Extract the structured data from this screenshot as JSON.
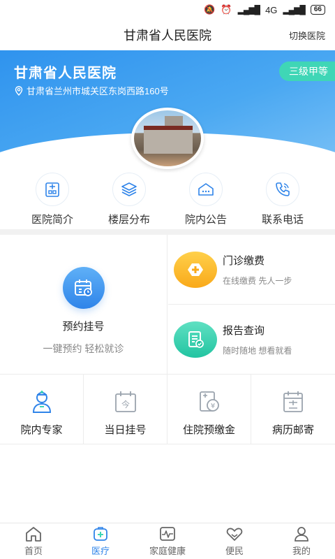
{
  "status_bar": {
    "network": "4G",
    "battery": "66"
  },
  "nav": {
    "title": "甘肃省人民医院",
    "switch_label": "切换医院"
  },
  "hero": {
    "name": "甘肃省人民医院",
    "address": "甘肃省兰州市城关区东岗西路160号",
    "level": "三级甲等",
    "photo_sign": "甘肃省人民医院"
  },
  "quick_menu": [
    {
      "label": "医院简介",
      "icon": "hospital-intro-icon"
    },
    {
      "label": "楼层分布",
      "icon": "floor-layers-icon"
    },
    {
      "label": "院内公告",
      "icon": "notice-icon"
    },
    {
      "label": "联系电话",
      "icon": "phone-icon"
    }
  ],
  "services": {
    "appointment": {
      "title": "预约挂号",
      "subtitle": "一键预约 轻松就诊"
    },
    "payment": {
      "title": "门诊缴费",
      "subtitle": "在线缴费 先人一步"
    },
    "report": {
      "title": "报告查询",
      "subtitle": "随时随地 想看就看"
    },
    "small": [
      {
        "label": "院内专家",
        "icon": "doctor-icon"
      },
      {
        "label": "当日挂号",
        "icon": "calendar-today-icon"
      },
      {
        "label": "住院预缴金",
        "icon": "deposit-icon"
      },
      {
        "label": "病历邮寄",
        "icon": "record-mail-icon"
      }
    ]
  },
  "tab_bar": [
    {
      "label": "首页",
      "icon": "home-icon"
    },
    {
      "label": "医疗",
      "icon": "medical-icon"
    },
    {
      "label": "家庭健康",
      "icon": "family-health-icon"
    },
    {
      "label": "便民",
      "icon": "heart-service-icon"
    },
    {
      "label": "我的",
      "icon": "profile-icon"
    }
  ],
  "colors": {
    "primary": "#2f84e9",
    "accent_green": "#3fd6b6",
    "accent_yellow": "#f9a91a"
  }
}
